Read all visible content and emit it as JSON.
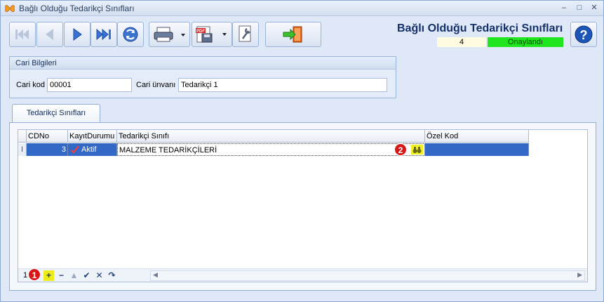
{
  "window": {
    "title": "Bağlı Olduğu Tedarikçi Sınıfları",
    "controls": [
      "–",
      "□",
      "✕"
    ]
  },
  "toolbar": {
    "icons": [
      "first-record-icon",
      "previous-record-icon",
      "next-record-icon",
      "last-record-icon",
      "refresh-icon",
      "print-icon",
      "pdf-export-icon",
      "settings-wrench-icon",
      "exit-door-icon"
    ]
  },
  "header": {
    "title": "Bağlı Olduğu Tedarikçi Sınıfları",
    "record_count": "4",
    "status": "Onaylandı",
    "status_color": "#1fe61f"
  },
  "cari": {
    "group_title": "Cari Bilgileri",
    "kod_label": "Cari kod",
    "kod_value": "00001",
    "unvan_label": "Cari ünvanı",
    "unvan_value": "Tedarikçi 1"
  },
  "tabs": [
    {
      "label": "Tedarikçi Sınıfları",
      "active": true
    }
  ],
  "grid": {
    "columns": [
      "CDNo",
      "KayıtDurumu",
      "Tedarikçi Sınıfı",
      "Özel Kod"
    ],
    "rows": [
      {
        "indicator": "I",
        "cdno": "3",
        "kayit_durumu": "Aktif",
        "tedarikci_sinifi": "MALZEME TEDARİKÇİLERİ",
        "ozel_kod": ""
      }
    ],
    "row_count": "1",
    "nav_buttons": [
      "+",
      "−",
      "▲",
      "✔",
      "✕",
      "↷"
    ]
  },
  "badges": {
    "add": "1",
    "lookup": "2"
  }
}
